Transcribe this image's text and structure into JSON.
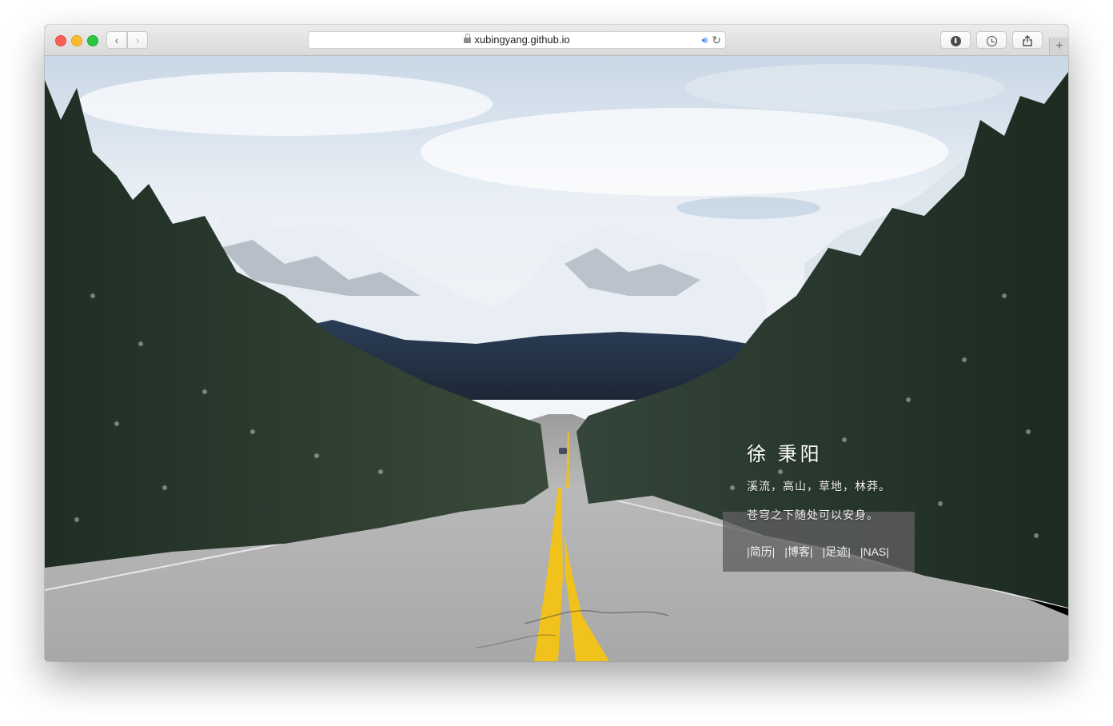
{
  "browser": {
    "url": "xubingyang.github.io",
    "icons": {
      "back": "chevron-left-icon",
      "forward": "chevron-right-icon",
      "secure": "lock-icon",
      "audio": "speaker-icon",
      "reload": "reload-icon",
      "download": "download-icon",
      "history": "clock-icon",
      "share": "share-icon",
      "new_tab": "plus-icon"
    }
  },
  "page": {
    "name": "徐 秉阳",
    "motto_line1": "溪流，高山，草地，林莽。",
    "motto_line2": "苍穹之下随处可以安身。",
    "links": [
      "|简历|",
      "|博客|",
      "|足迹|",
      "|NAS|"
    ]
  },
  "colors": {
    "accent_blue": "#3a86e8",
    "panel": "#5f5f5f",
    "road_line": "#f1c21b"
  }
}
